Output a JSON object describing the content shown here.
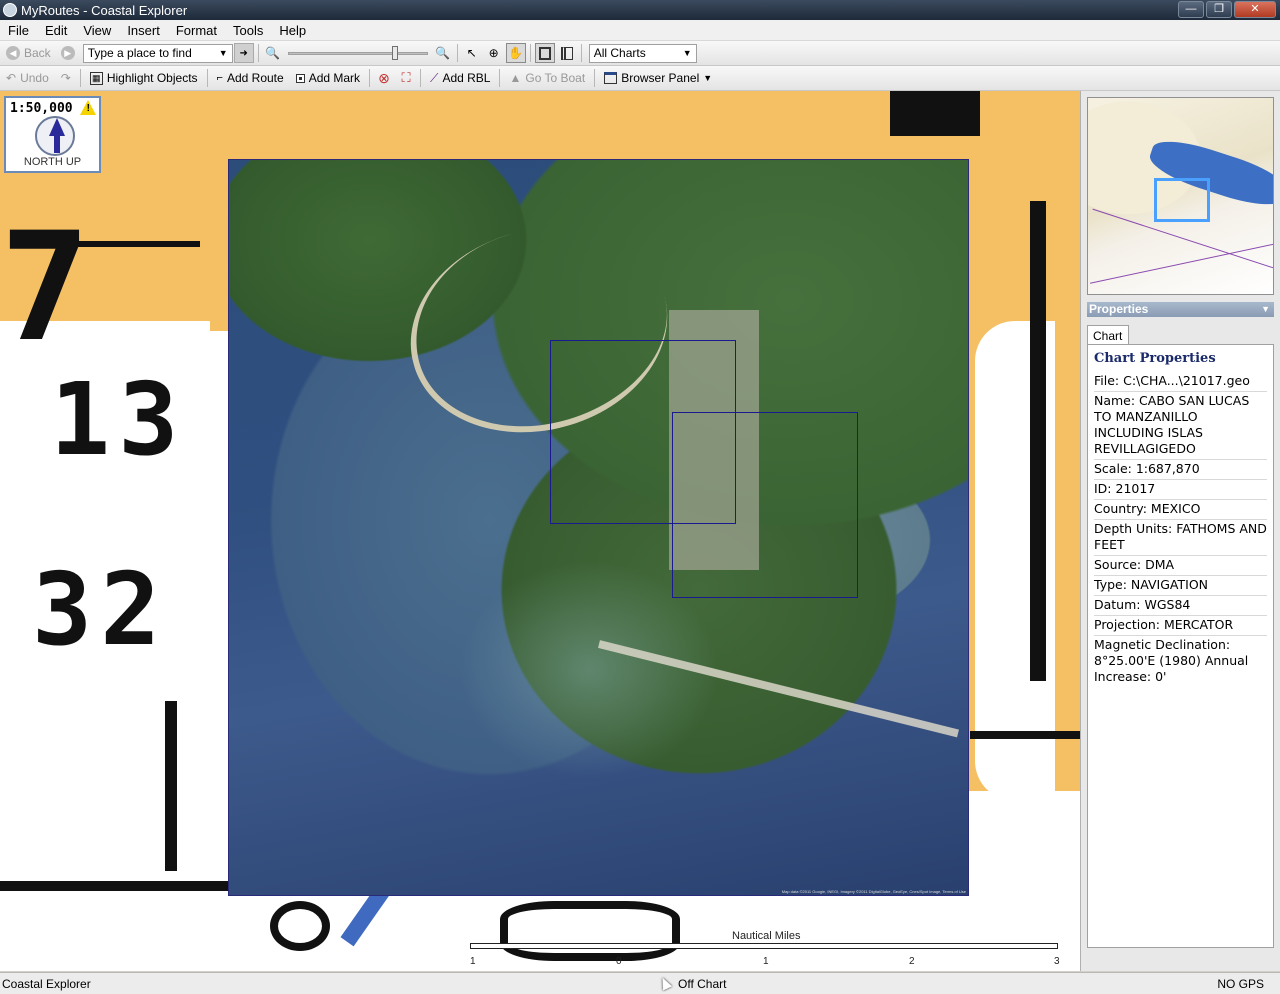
{
  "window": {
    "title": "MyRoutes - Coastal Explorer"
  },
  "menu": [
    "File",
    "Edit",
    "View",
    "Insert",
    "Format",
    "Tools",
    "Help"
  ],
  "toolbar1": {
    "back_label": "Back",
    "search_placeholder": "Type a place to find",
    "zoom_level_fraction": 0.77,
    "charts_select": "All Charts"
  },
  "toolbar2": {
    "undo_label": "Undo",
    "highlight_label": "Highlight Objects",
    "add_route_label": "Add Route",
    "add_mark_label": "Add Mark",
    "add_rbl_label": "Add RBL",
    "go_to_boat_label": "Go To Boat",
    "browser_panel_label": "Browser Panel"
  },
  "map": {
    "scale_text": "1:50,000",
    "orientation_text": "NORTH UP",
    "depth_labels": [
      "7",
      "13",
      "32"
    ],
    "scale_bar": {
      "title": "Nautical Miles",
      "ticks": [
        "1",
        "0",
        "1",
        "2",
        "3"
      ]
    },
    "imagery_credit": "Map data ©2011 Google, INEGI, Imagery ©2011 DigitalGlobe, GeoEye, Cnes/Spot Image, Terms of Use"
  },
  "panel": {
    "properties_header": "Properties",
    "tab_label": "Chart",
    "title": "Chart Properties",
    "rows": [
      "File: C:\\CHA...\\21017.geo",
      "Name: CABO SAN LUCAS TO MANZANILLO INCLUDING ISLAS REVILLAGIGEDO",
      "Scale: 1:687,870",
      "ID: 21017",
      "Country: MEXICO",
      "Depth Units: FATHOMS AND FEET",
      "Source: DMA",
      "Type: NAVIGATION",
      "Datum: WGS84",
      "Projection: MERCATOR",
      "Magnetic Declination: 8°25.00'E (1980) Annual Increase: 0'"
    ]
  },
  "status": {
    "left": "Coastal Explorer",
    "middle": "Off Chart",
    "right": "NO GPS"
  },
  "colors": {
    "land": "#f5c064",
    "chart_frame": "#1a1a90",
    "overview_frame": "#4aa0ff"
  }
}
